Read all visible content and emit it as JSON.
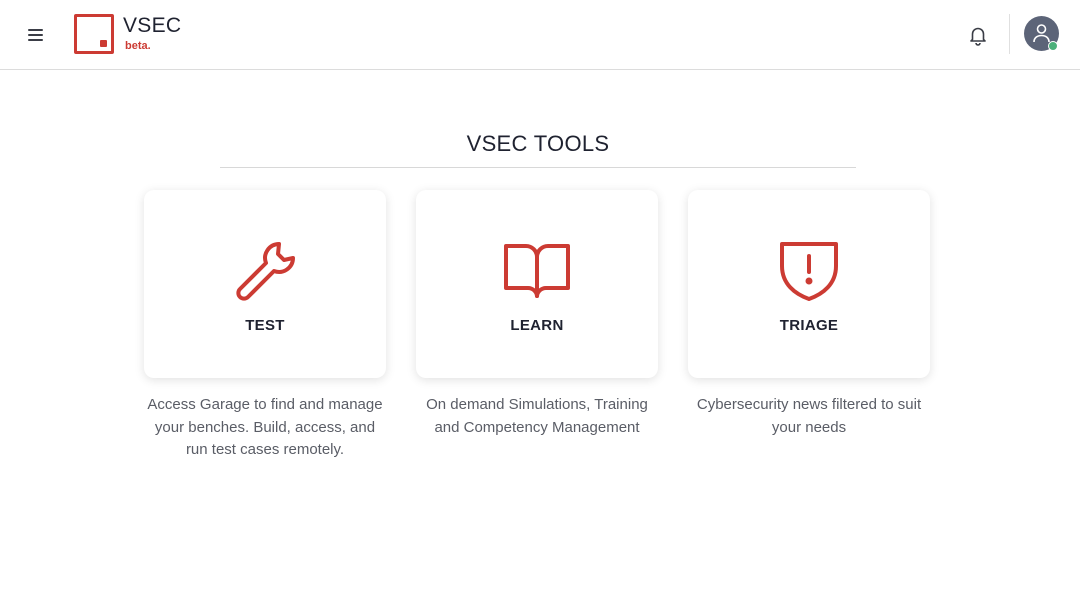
{
  "header": {
    "brand": "VSEC",
    "badge": "beta."
  },
  "main": {
    "title": "VSEC TOOLS",
    "tools": [
      {
        "label": "TEST",
        "icon": "wrench-icon",
        "description": "Access Garage to find and manage your benches. Build, access, and run test cases remotely."
      },
      {
        "label": "LEARN",
        "icon": "book-icon",
        "description": "On demand Simulations, Training and Competency Management"
      },
      {
        "label": "TRIAGE",
        "icon": "shield-alert-icon",
        "description": "Cybersecurity news filtered to suit your needs"
      }
    ]
  },
  "colors": {
    "accent": "#cc3b33",
    "status_online": "#4bb07a",
    "avatar_bg": "#5c6478"
  }
}
